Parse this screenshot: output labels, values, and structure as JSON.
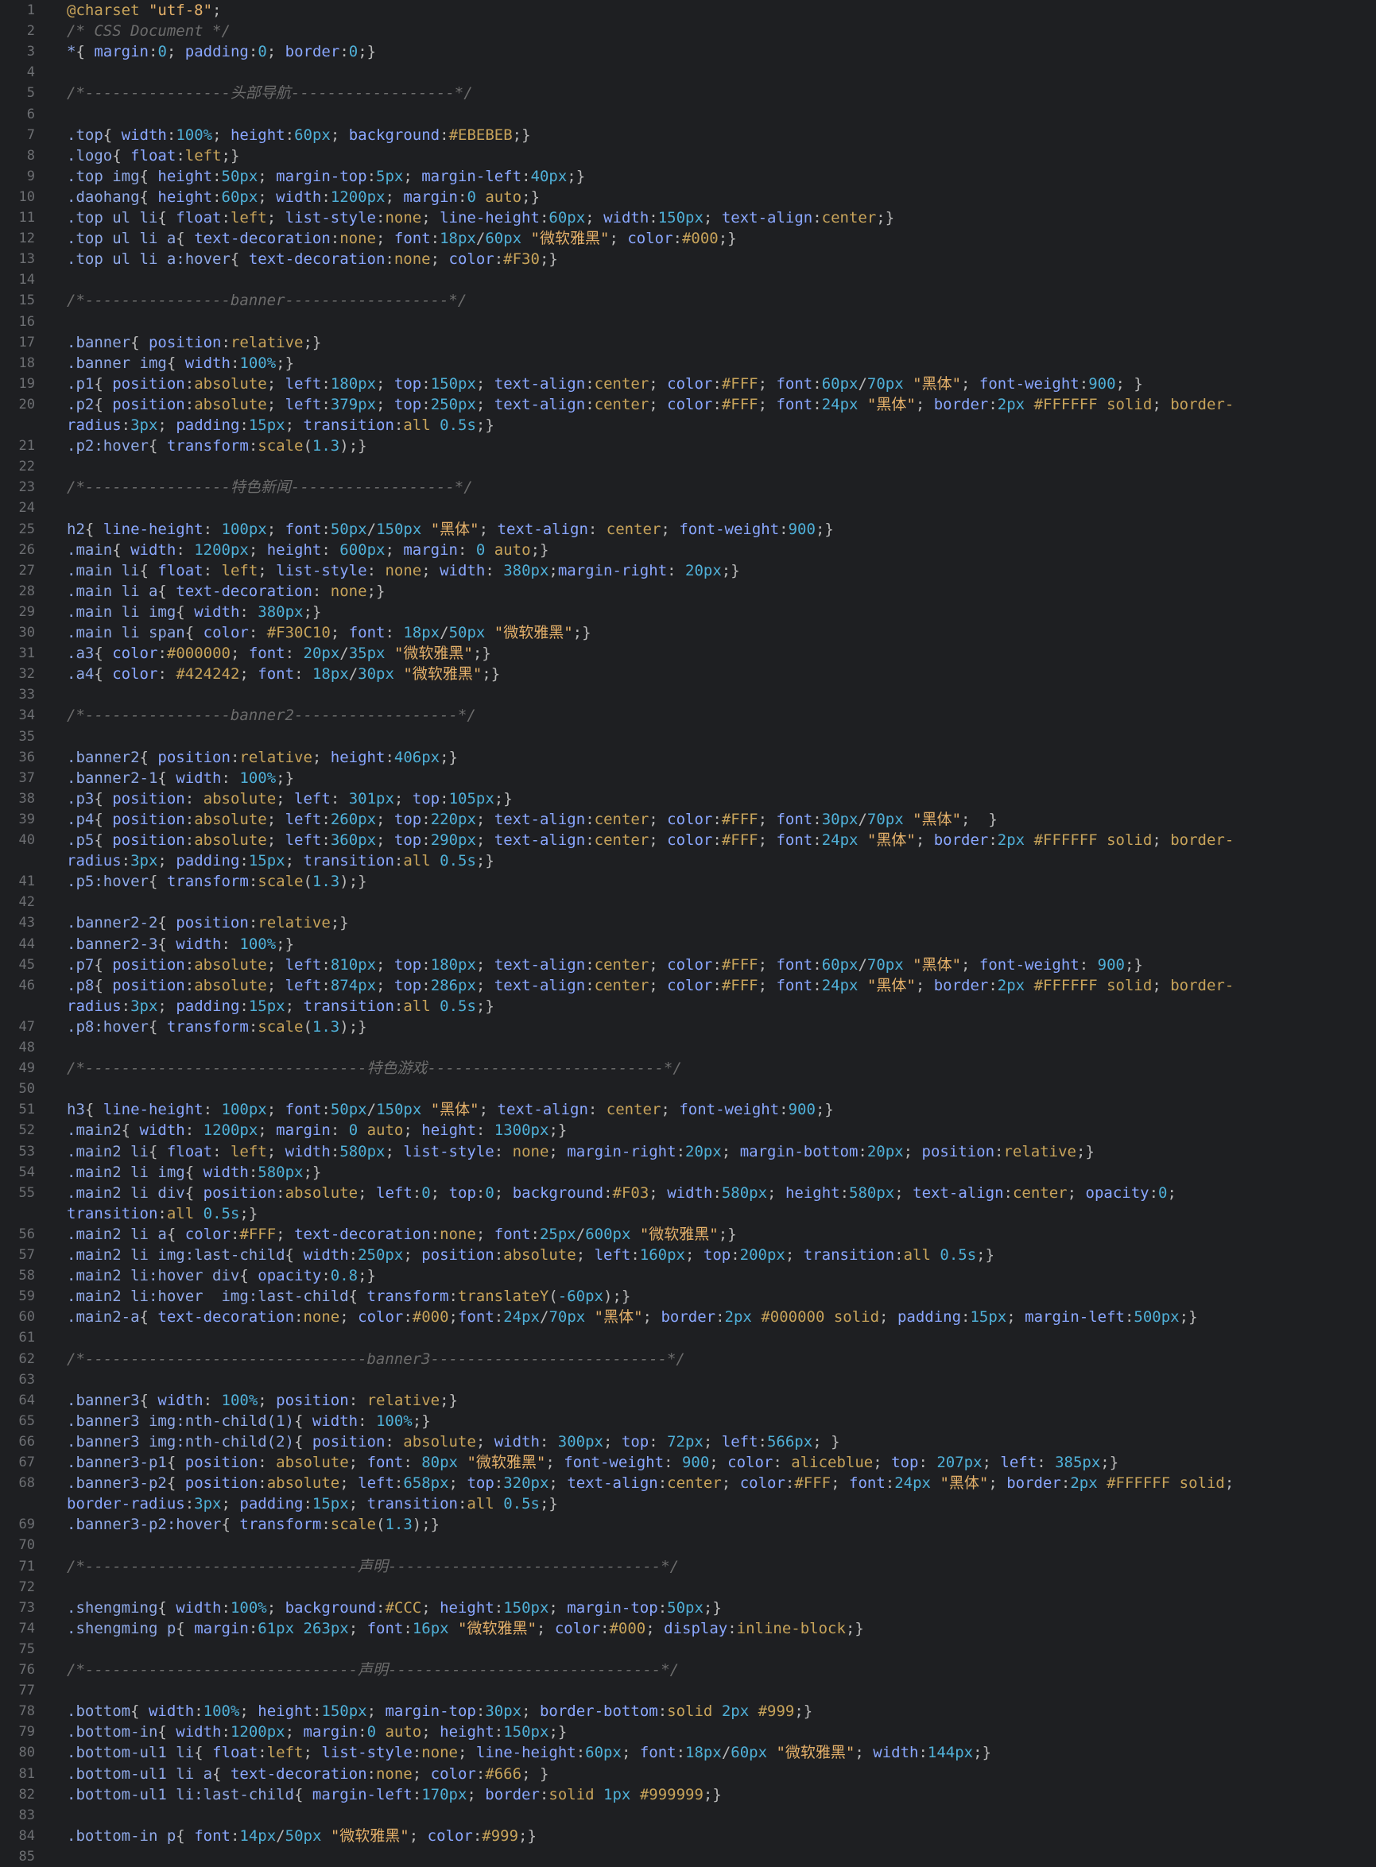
{
  "editor": {
    "lines": [
      {
        "n": "1",
        "t": "@charset \"utf-8\";"
      },
      {
        "n": "2",
        "t": "/* CSS Document */"
      },
      {
        "n": "3",
        "t": "*{ margin:0; padding:0; border:0;}"
      },
      {
        "n": "4",
        "t": ""
      },
      {
        "n": "5",
        "t": "/*----------------头部导航------------------*/"
      },
      {
        "n": "6",
        "t": ""
      },
      {
        "n": "7",
        "t": ".top{ width:100%; height:60px; background:#EBEBEB;}"
      },
      {
        "n": "8",
        "t": ".logo{ float:left;}"
      },
      {
        "n": "9",
        "t": ".top img{ height:50px; margin-top:5px; margin-left:40px;}"
      },
      {
        "n": "10",
        "t": ".daohang{ height:60px; width:1200px; margin:0 auto;}"
      },
      {
        "n": "11",
        "t": ".top ul li{ float:left; list-style:none; line-height:60px; width:150px; text-align:center;}"
      },
      {
        "n": "12",
        "t": ".top ul li a{ text-decoration:none; font:18px/60px \"微软雅黑\"; color:#000;}"
      },
      {
        "n": "13",
        "t": ".top ul li a:hover{ text-decoration:none; color:#F30;}"
      },
      {
        "n": "14",
        "t": ""
      },
      {
        "n": "15",
        "t": "/*----------------banner------------------*/"
      },
      {
        "n": "16",
        "t": ""
      },
      {
        "n": "17",
        "t": ".banner{ position:relative;}"
      },
      {
        "n": "18",
        "t": ".banner img{ width:100%;}"
      },
      {
        "n": "19",
        "t": ".p1{ position:absolute; left:180px; top:150px; text-align:center; color:#FFF; font:60px/70px \"黑体\"; font-weight:900; }"
      },
      {
        "n": "20",
        "t": ".p2{ position:absolute; left:379px; top:250px; text-align:center; color:#FFF; font:24px \"黑体\"; border:2px #FFFFFF solid; border-",
        "w": "radius:3px; padding:15px; transition:all 0.5s;}"
      },
      {
        "n": "21",
        "t": ".p2:hover{ transform:scale(1.3);}"
      },
      {
        "n": "22",
        "t": ""
      },
      {
        "n": "23",
        "t": "/*----------------特色新闻------------------*/"
      },
      {
        "n": "24",
        "t": ""
      },
      {
        "n": "25",
        "t": "h2{ line-height: 100px; font:50px/150px \"黑体\"; text-align: center; font-weight:900;}"
      },
      {
        "n": "26",
        "t": ".main{ width: 1200px; height: 600px; margin: 0 auto;}"
      },
      {
        "n": "27",
        "t": ".main li{ float: left; list-style: none; width: 380px;margin-right: 20px;}"
      },
      {
        "n": "28",
        "t": ".main li a{ text-decoration: none;}"
      },
      {
        "n": "29",
        "t": ".main li img{ width: 380px;}"
      },
      {
        "n": "30",
        "t": ".main li span{ color: #F30C10; font: 18px/50px \"微软雅黑\";}"
      },
      {
        "n": "31",
        "t": ".a3{ color:#000000; font: 20px/35px \"微软雅黑\";}"
      },
      {
        "n": "32",
        "t": ".a4{ color: #424242; font: 18px/30px \"微软雅黑\";}"
      },
      {
        "n": "33",
        "t": ""
      },
      {
        "n": "34",
        "t": "/*----------------banner2------------------*/"
      },
      {
        "n": "35",
        "t": ""
      },
      {
        "n": "36",
        "t": ".banner2{ position:relative; height:406px;}"
      },
      {
        "n": "37",
        "t": ".banner2-1{ width: 100%;}"
      },
      {
        "n": "38",
        "t": ".p3{ position: absolute; left: 301px; top:105px;}"
      },
      {
        "n": "39",
        "t": ".p4{ position:absolute; left:260px; top:220px; text-align:center; color:#FFF; font:30px/70px \"黑体\";  }"
      },
      {
        "n": "40",
        "t": ".p5{ position:absolute; left:360px; top:290px; text-align:center; color:#FFF; font:24px \"黑体\"; border:2px #FFFFFF solid; border-",
        "w": "radius:3px; padding:15px; transition:all 0.5s;}"
      },
      {
        "n": "41",
        "t": ".p5:hover{ transform:scale(1.3);}"
      },
      {
        "n": "42",
        "t": ""
      },
      {
        "n": "43",
        "t": ".banner2-2{ position:relative;}"
      },
      {
        "n": "44",
        "t": ".banner2-3{ width: 100%;}"
      },
      {
        "n": "45",
        "t": ".p7{ position:absolute; left:810px; top:180px; text-align:center; color:#FFF; font:60px/70px \"黑体\"; font-weight: 900;}"
      },
      {
        "n": "46",
        "t": ".p8{ position:absolute; left:874px; top:286px; text-align:center; color:#FFF; font:24px \"黑体\"; border:2px #FFFFFF solid; border-",
        "w": "radius:3px; padding:15px; transition:all 0.5s;}"
      },
      {
        "n": "47",
        "t": ".p8:hover{ transform:scale(1.3);}"
      },
      {
        "n": "48",
        "t": ""
      },
      {
        "n": "49",
        "t": "/*-------------------------------特色游戏--------------------------*/"
      },
      {
        "n": "50",
        "t": ""
      },
      {
        "n": "51",
        "t": "h3{ line-height: 100px; font:50px/150px \"黑体\"; text-align: center; font-weight:900;}"
      },
      {
        "n": "52",
        "t": ".main2{ width: 1200px; margin: 0 auto; height: 1300px;}"
      },
      {
        "n": "53",
        "t": ".main2 li{ float: left; width:580px; list-style: none; margin-right:20px; margin-bottom:20px; position:relative;}"
      },
      {
        "n": "54",
        "t": ".main2 li img{ width:580px;}"
      },
      {
        "n": "55",
        "t": ".main2 li div{ position:absolute; left:0; top:0; background:#F03; width:580px; height:580px; text-align:center; opacity:0;",
        "w": "transition:all 0.5s;}"
      },
      {
        "n": "56",
        "t": ".main2 li a{ color:#FFF; text-decoration:none; font:25px/600px \"微软雅黑\";}"
      },
      {
        "n": "57",
        "t": ".main2 li img:last-child{ width:250px; position:absolute; left:160px; top:200px; transition:all 0.5s;}"
      },
      {
        "n": "58",
        "t": ".main2 li:hover div{ opacity:0.8;}"
      },
      {
        "n": "59",
        "t": ".main2 li:hover  img:last-child{ transform:translateY(-60px);}"
      },
      {
        "n": "60",
        "t": ".main2-a{ text-decoration:none; color:#000;font:24px/70px \"黑体\"; border:2px #000000 solid; padding:15px; margin-left:500px;}"
      },
      {
        "n": "61",
        "t": ""
      },
      {
        "n": "62",
        "t": "/*-------------------------------banner3--------------------------*/"
      },
      {
        "n": "63",
        "t": ""
      },
      {
        "n": "64",
        "t": ".banner3{ width: 100%; position: relative;}"
      },
      {
        "n": "65",
        "t": ".banner3 img:nth-child(1){ width: 100%;}"
      },
      {
        "n": "66",
        "t": ".banner3 img:nth-child(2){ position: absolute; width: 300px; top: 72px; left:566px; }"
      },
      {
        "n": "67",
        "t": ".banner3-p1{ position: absolute; font: 80px \"微软雅黑\"; font-weight: 900; color: aliceblue; top: 207px; left: 385px;}"
      },
      {
        "n": "68",
        "t": ".banner3-p2{ position:absolute; left:658px; top:320px; text-align:center; color:#FFF; font:24px \"黑体\"; border:2px #FFFFFF solid;",
        "w": "border-radius:3px; padding:15px; transition:all 0.5s;}"
      },
      {
        "n": "69",
        "t": ".banner3-p2:hover{ transform:scale(1.3);}"
      },
      {
        "n": "70",
        "t": ""
      },
      {
        "n": "71",
        "t": "/*------------------------------声明------------------------------*/"
      },
      {
        "n": "72",
        "t": ""
      },
      {
        "n": "73",
        "t": ".shengming{ width:100%; background:#CCC; height:150px; margin-top:50px;}"
      },
      {
        "n": "74",
        "t": ".shengming p{ margin:61px 263px; font:16px \"微软雅黑\"; color:#000; display:inline-block;}"
      },
      {
        "n": "75",
        "t": ""
      },
      {
        "n": "76",
        "t": "/*------------------------------声明------------------------------*/"
      },
      {
        "n": "77",
        "t": ""
      },
      {
        "n": "78",
        "t": ".bottom{ width:100%; height:150px; margin-top:30px; border-bottom:solid 2px #999;}"
      },
      {
        "n": "79",
        "t": ".bottom-in{ width:1200px; margin:0 auto; height:150px;}"
      },
      {
        "n": "80",
        "t": ".bottom-ul1 li{ float:left; list-style:none; line-height:60px; font:18px/60px \"微软雅黑\"; width:144px;}"
      },
      {
        "n": "81",
        "t": ".bottom-ul1 li a{ text-decoration:none; color:#666; }"
      },
      {
        "n": "82",
        "t": ".bottom-ul1 li:last-child{ margin-left:170px; border:solid 1px #999999;}"
      },
      {
        "n": "83",
        "t": ""
      },
      {
        "n": "84",
        "t": ".bottom-in p{ font:14px/50px \"微软雅黑\"; color:#999;}"
      },
      {
        "n": "85",
        "t": ""
      }
    ]
  },
  "colors": {
    "background": "#1e1f22",
    "gutter": "#6d6f73",
    "selector": "#8fa9e8",
    "property": "#8aa7ff",
    "number": "#4fb0d8",
    "string": "#e5b16a",
    "keyword": "#c7a35a",
    "comment": "#6c6c6c"
  }
}
